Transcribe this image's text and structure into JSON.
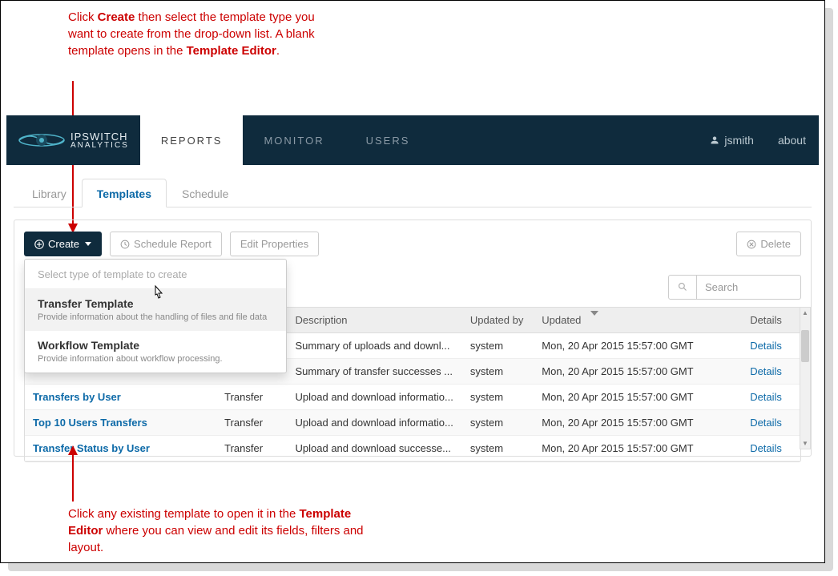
{
  "annotations": {
    "top": "Click <b>Create</b> then select the template type you want to create from the drop-down list. A blank template opens in the <b>Template Editor</b>.",
    "bottom": "Click any existing template to open it in the <b>Template Editor</b> where you can view and edit its fields, filters and layout."
  },
  "brand": {
    "line1": "IPSWITCH",
    "line2": "ANALYTICS"
  },
  "nav": {
    "reports": "REPORTS",
    "monitor": "MONITOR",
    "users": "USERS",
    "user_label": "jsmith",
    "about": "about"
  },
  "subtabs": {
    "library": "Library",
    "templates": "Templates",
    "schedule": "Schedule"
  },
  "toolbar": {
    "create": "Create",
    "schedule_report": "Schedule Report",
    "edit_properties": "Edit Properties",
    "delete": "Delete"
  },
  "dropdown": {
    "header": "Select type of template to create",
    "items": [
      {
        "title": "Transfer Template",
        "desc": "Provide information about the handling of files and file data"
      },
      {
        "title": "Workflow Template",
        "desc": "Provide information about workflow processing."
      }
    ]
  },
  "search": {
    "placeholder": "Search"
  },
  "table": {
    "headers": {
      "name": "",
      "type": "",
      "desc": "Description",
      "by": "Updated by",
      "updated": "Updated",
      "details": "Details"
    },
    "rows": [
      {
        "name": "",
        "type": "",
        "desc": "Summary of uploads and downl...",
        "by": "system",
        "updated": "Mon, 20 Apr 2015 15:57:00 GMT",
        "details": "Details"
      },
      {
        "name": "",
        "type": "",
        "desc": "Summary of transfer successes ...",
        "by": "system",
        "updated": "Mon, 20 Apr 2015 15:57:00 GMT",
        "details": "Details"
      },
      {
        "name": "Transfers by User",
        "type": "Transfer",
        "desc": "Upload and download informatio...",
        "by": "system",
        "updated": "Mon, 20 Apr 2015 15:57:00 GMT",
        "details": "Details"
      },
      {
        "name": "Top 10 Users Transfers",
        "type": "Transfer",
        "desc": "Upload and download informatio...",
        "by": "system",
        "updated": "Mon, 20 Apr 2015 15:57:00 GMT",
        "details": "Details"
      },
      {
        "name": "Transfer Status by User",
        "type": "Transfer",
        "desc": "Upload and download successe...",
        "by": "system",
        "updated": "Mon, 20 Apr 2015 15:57:00 GMT",
        "details": "Details"
      }
    ]
  }
}
